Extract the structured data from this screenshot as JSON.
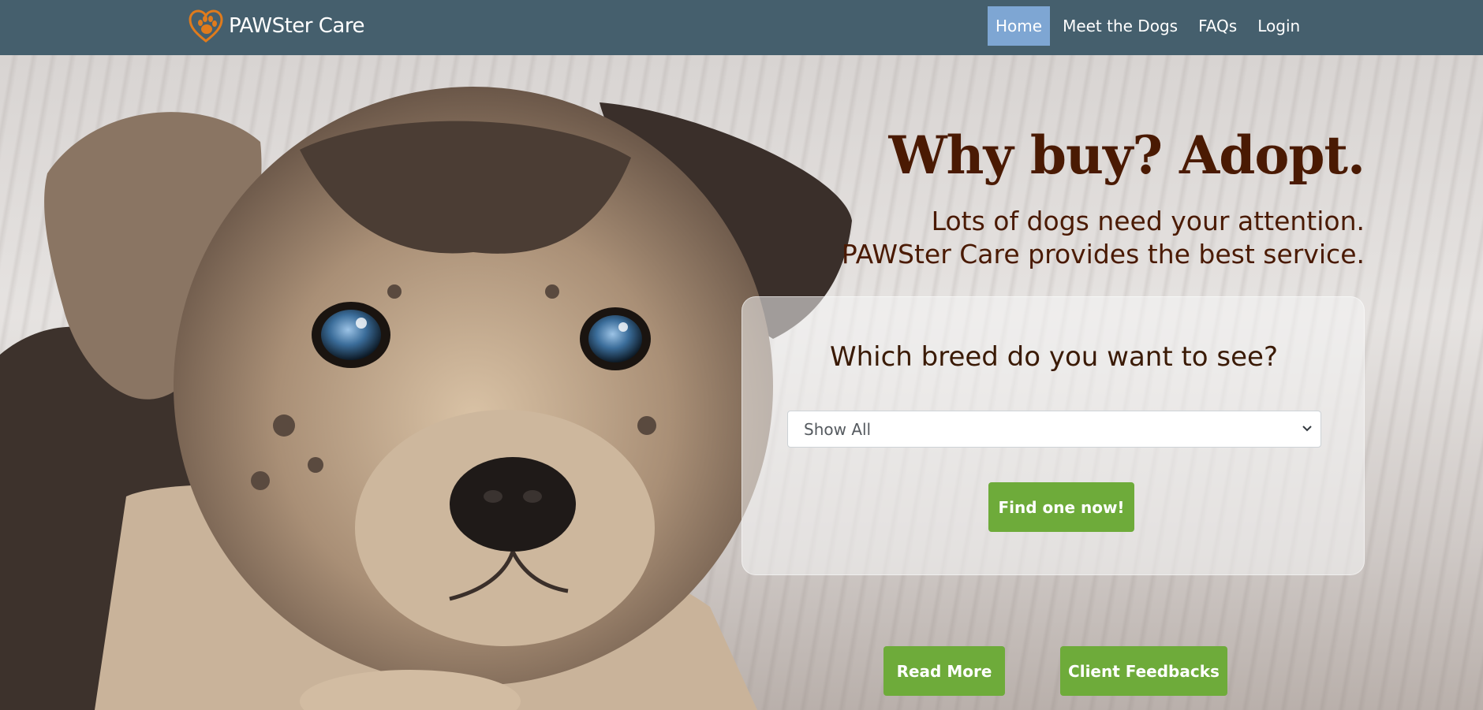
{
  "navbar": {
    "brand": "PAWSter Care",
    "links": [
      {
        "label": "Home",
        "active": true
      },
      {
        "label": "Meet the Dogs",
        "active": false
      },
      {
        "label": "FAQs",
        "active": false
      },
      {
        "label": "Login",
        "active": false
      }
    ]
  },
  "hero": {
    "headline": "Why buy? Adopt.",
    "tagline_line1": "Lots of dogs need your attention.",
    "tagline_line2": "PAWSter Care provides the best service.",
    "breed_prompt": "Which breed do you want to see?",
    "breed_select_value": "Show All",
    "find_button": "Find one now!",
    "read_more_button": "Read More",
    "feedback_button": "Client Feedbacks"
  },
  "colors": {
    "navbar_bg": "#455f6d",
    "active_link_bg": "#7ea6d3",
    "button_green": "#6eab3a",
    "headline_brown": "#4a1a03",
    "logo_orange": "#e07b1c"
  },
  "icons": {
    "brand_logo": "heart-paw-icon",
    "select_chevron": "chevron-down-icon"
  }
}
